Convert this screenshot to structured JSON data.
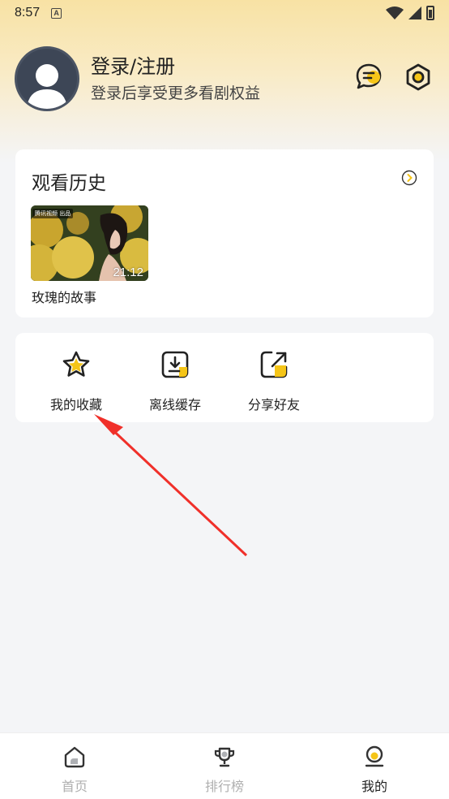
{
  "status_bar": {
    "time": "8:57",
    "notification_icon": "A"
  },
  "profile": {
    "title": "登录/注册",
    "subtitle": "登录后享受更多看剧权益",
    "avatar_icon": "user-avatar-icon"
  },
  "header_icons": {
    "message": "message-icon",
    "settings": "settings-icon"
  },
  "history": {
    "title": "观看历史",
    "items": [
      {
        "title": "玫瑰的故事",
        "duration": "21:12",
        "tag": "腾讯视频 出品"
      }
    ]
  },
  "actions": [
    {
      "label": "我的收藏",
      "icon": "star-icon"
    },
    {
      "label": "离线缓存",
      "icon": "download-icon"
    },
    {
      "label": "分享好友",
      "icon": "share-icon"
    }
  ],
  "bottom_nav": [
    {
      "label": "首页",
      "icon": "home-icon",
      "active": false
    },
    {
      "label": "排行榜",
      "icon": "trophy-icon",
      "active": false
    },
    {
      "label": "我的",
      "icon": "profile-icon",
      "active": true
    }
  ],
  "colors": {
    "accent": "#f5c518",
    "annotation": "#f0302a"
  }
}
